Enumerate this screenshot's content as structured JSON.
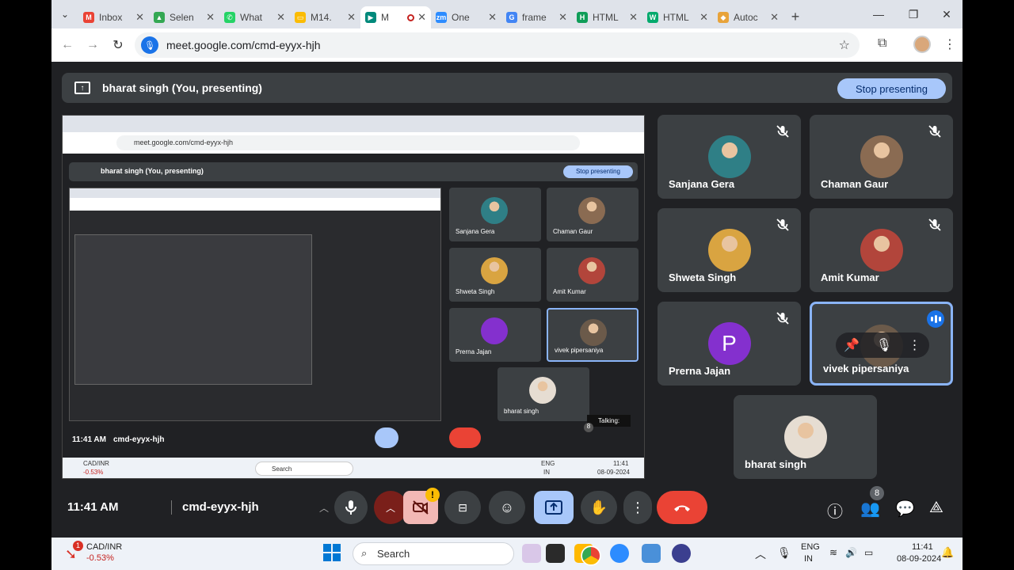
{
  "browser": {
    "tabs": [
      {
        "title": "Inbox",
        "icon": "gmail-icon",
        "color": "#ea4335",
        "glyph": "M"
      },
      {
        "title": "Selen",
        "icon": "drive-icon",
        "color": "#34a853",
        "glyph": "▲"
      },
      {
        "title": "What",
        "icon": "whatsapp-icon",
        "color": "#25d366",
        "glyph": "✆"
      },
      {
        "title": "M14.",
        "icon": "slides-icon",
        "color": "#fbbc04",
        "glyph": "▭"
      },
      {
        "title": "M",
        "icon": "meet-icon",
        "color": "#00897b",
        "glyph": "▶",
        "active": true
      },
      {
        "title": "One",
        "icon": "zoom-icon",
        "color": "#2d8cff",
        "glyph": "zm"
      },
      {
        "title": "frame",
        "icon": "google-icon",
        "color": "#4285f4",
        "glyph": "G"
      },
      {
        "title": "HTML",
        "icon": "html-icon",
        "color": "#0f9d58",
        "glyph": "H"
      },
      {
        "title": "HTML",
        "icon": "w3schools-icon",
        "color": "#04aa6d",
        "glyph": "W"
      },
      {
        "title": "Autoc",
        "icon": "extension-icon",
        "color": "#e8a33a",
        "glyph": "◆"
      }
    ],
    "url": "meet.google.com/cmd-eyyx-hjh"
  },
  "banner": {
    "text": "bharat singh (You, presenting)",
    "stop_label": "Stop presenting"
  },
  "participants": [
    {
      "name": "Sanjana Gera",
      "avatar": "photo",
      "color": "#2f7f86"
    },
    {
      "name": "Chaman Gaur",
      "avatar": "photo",
      "color": "#8a6b52"
    },
    {
      "name": "Shweta Singh",
      "avatar": "photo",
      "color": "#d9a441"
    },
    {
      "name": "Amit Kumar",
      "avatar": "photo",
      "color": "#b2453b"
    },
    {
      "name": "Prerna Jajan",
      "avatar": "letter",
      "letter": "P",
      "color": "#8430ce"
    },
    {
      "name": "vivek pipersaniya",
      "avatar": "photo",
      "color": "#6b5a4a",
      "active": true
    },
    {
      "name": "bharat singh",
      "avatar": "photo",
      "color": "#e6ddd2"
    }
  ],
  "shared_screen": {
    "url": "meet.google.com/cmd-eyyx-hjh",
    "banner_text": "bharat singh (You, presenting)",
    "stop_label": "Stop presenting",
    "clock": "11:41 AM",
    "meeting_code": "cmd-eyyx-hjh",
    "talking_label": "Talking:",
    "people_count": "8",
    "search_label": "Search",
    "lang": "ENG",
    "lang2": "IN",
    "time": "11:41",
    "date": "08-09-2024",
    "ticker": "CAD/INR",
    "ticker_value": "-0.53%"
  },
  "controls": {
    "clock": "11:41 AM",
    "meeting_code": "cmd-eyyx-hjh",
    "people_count": "8",
    "warning_glyph": "!"
  },
  "taskbar": {
    "ticker": "CAD/INR",
    "ticker_value": "-0.53%",
    "badge": "1",
    "search_label": "Search",
    "lang": "ENG",
    "lang2": "IN",
    "time": "11:41",
    "date": "08-09-2024"
  }
}
